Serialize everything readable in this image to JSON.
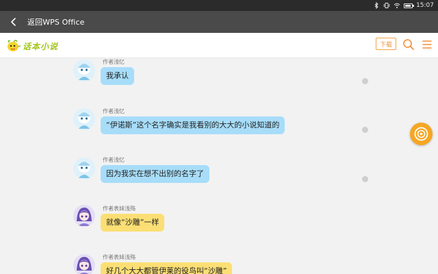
{
  "status_bar": {
    "time": "15:07",
    "icons": [
      "bluetooth-icon",
      "vibrate-icon",
      "wifi-icon",
      "battery-icon"
    ]
  },
  "nav": {
    "back_icon": "chevron-left-icon",
    "title": "返回WPS Office"
  },
  "site_header": {
    "logo_text": "话本小说",
    "download_label": "下载",
    "icons": [
      "search-icon",
      "menu-icon"
    ],
    "accent_color": "#f0903a"
  },
  "messages": [
    {
      "author": "作者浅忆",
      "text": "我承认",
      "bubble_color": "#a7ddf9"
    },
    {
      "author": "作者浅忆",
      "text": "“伊诺斯”这个名字确实是我看别的大大的小说知道的",
      "bubble_color": "#a7ddf9"
    },
    {
      "author": "作者浅忆",
      "text": "因为我实在想不出别的名字了",
      "bubble_color": "#a7ddf9"
    },
    {
      "author": "作者表妹浅殇",
      "text": "就像“沙雕”一样",
      "bubble_color": "#fbdf74"
    },
    {
      "author": "作者表妹浅殇",
      "text": "好几个大大都管伊莱的役鸟叫“沙雕”",
      "bubble_color": "#fbdf74"
    }
  ],
  "floating_button": {
    "icon": "target-icon",
    "color": "#f5a623"
  }
}
